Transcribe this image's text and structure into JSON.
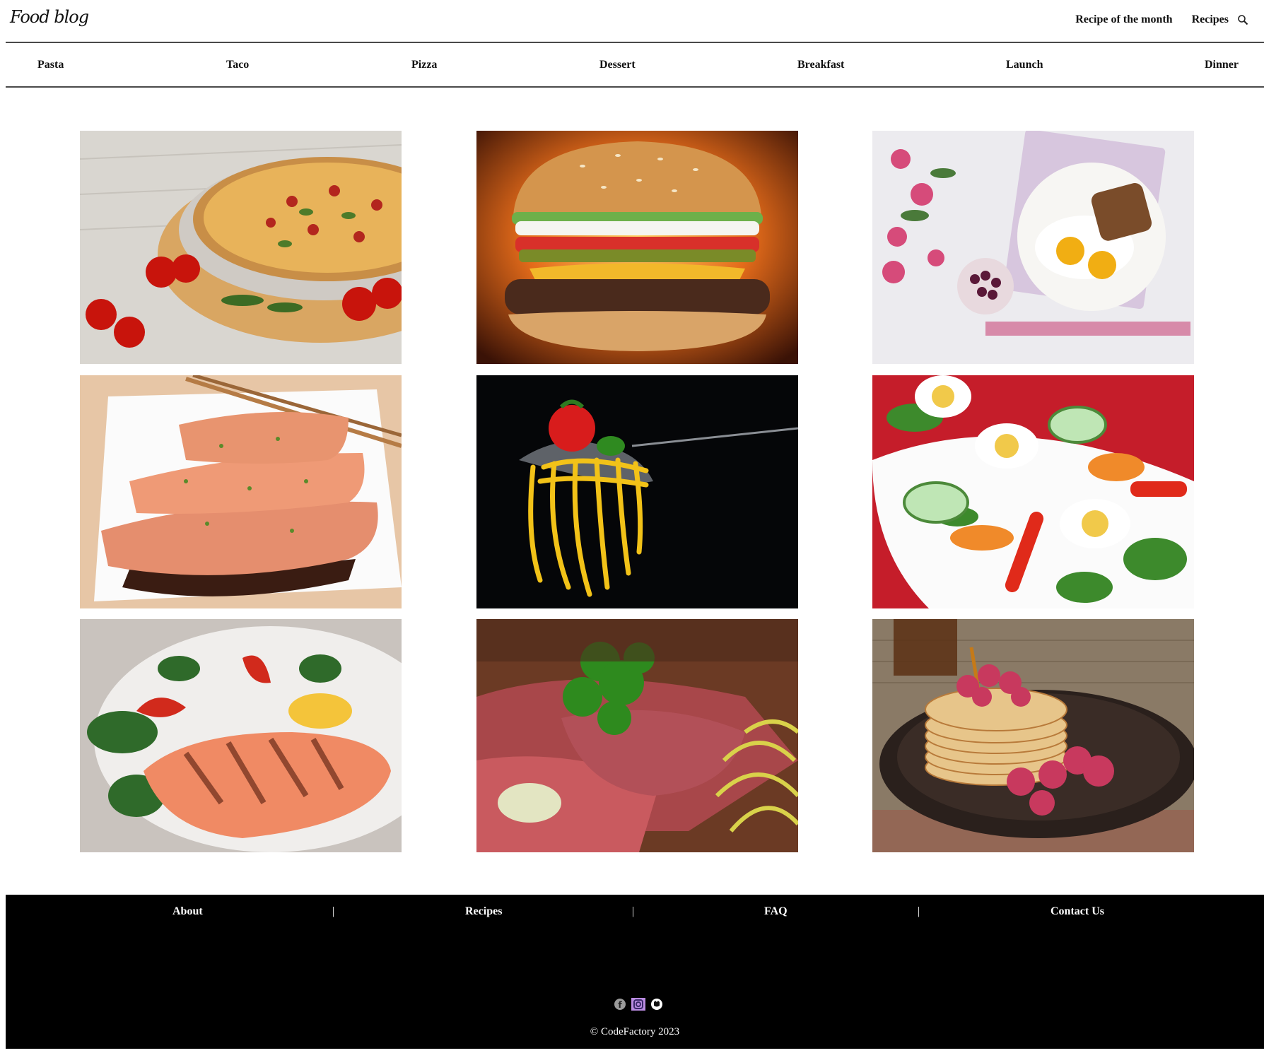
{
  "header": {
    "logo_text": "Food blog",
    "nav": [
      {
        "label": "Recipe of the month"
      },
      {
        "label": "Recipes"
      }
    ],
    "search_icon": "search-icon"
  },
  "categories": [
    {
      "label": "Pasta"
    },
    {
      "label": "Taco"
    },
    {
      "label": "Pizza"
    },
    {
      "label": "Dessert"
    },
    {
      "label": "Breakfast"
    },
    {
      "label": "Launch"
    },
    {
      "label": "Dinner"
    }
  ],
  "gallery": {
    "images": [
      {
        "subject": "pizza"
      },
      {
        "subject": "burger"
      },
      {
        "subject": "breakfast-tray"
      },
      {
        "subject": "salmon-steaks"
      },
      {
        "subject": "spaghetti-fork"
      },
      {
        "subject": "egg-salad"
      },
      {
        "subject": "grilled-salmon"
      },
      {
        "subject": "steak"
      },
      {
        "subject": "pancakes"
      }
    ]
  },
  "footer": {
    "links": [
      {
        "label": "About"
      },
      {
        "label": "Recipes"
      },
      {
        "label": "FAQ"
      },
      {
        "label": "Contact Us"
      }
    ],
    "separator": "|",
    "social_icons": [
      "facebook-icon",
      "instagram-icon",
      "github-icon"
    ],
    "copyright": "© CodeFactory 2023"
  },
  "colors": {
    "footer_bg": "#000000",
    "text": "#111111",
    "rule": "#4a4a4a"
  }
}
